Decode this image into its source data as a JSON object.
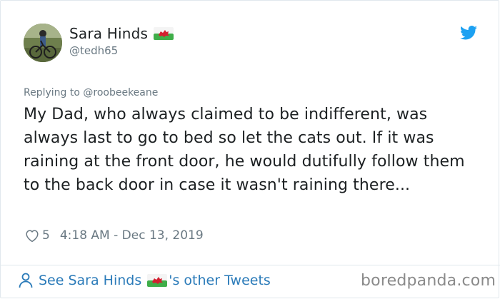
{
  "user": {
    "display_name": "Sara Hinds",
    "handle": "@tedh65",
    "flag_icon": "wales-flag-icon"
  },
  "tweet": {
    "reply_context": "Replying to @roobeekeane",
    "text": "My Dad, who always claimed to be indifferent, was always last to go to bed so let the cats out. If it was raining at the front door, he would dutifully follow them to the back door in case it wasn't raining there...",
    "like_count": "5",
    "timestamp": "4:18 AM - Dec 13, 2019"
  },
  "footer": {
    "link_prefix": "See Sara Hinds",
    "link_suffix": "'s other Tweets",
    "watermark": "boredpanda.com"
  },
  "colors": {
    "link_blue": "#2b7bb9",
    "twitter_blue": "#1da1f2",
    "meta_gray": "#697882"
  }
}
